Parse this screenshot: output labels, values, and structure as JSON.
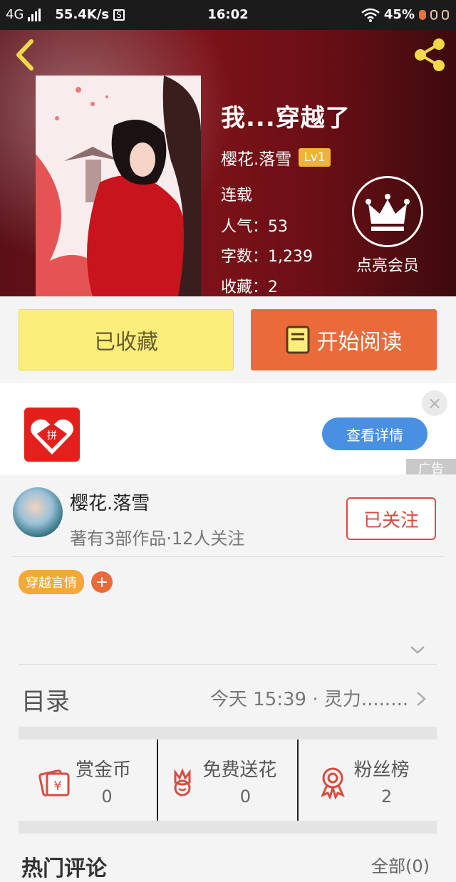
{
  "status_bar": {
    "network": "4G",
    "speed": "55.4K/s",
    "speed_icon": "S",
    "time": "16:02",
    "battery": "45%"
  },
  "hero": {
    "title": "我...穿越了",
    "author": "樱花.落雪",
    "level": "Lv1",
    "status": "连载",
    "popularity": "人气：53",
    "word_count": "字数：1,239",
    "favorites": "收藏：2",
    "vip_label": "点亮会员"
  },
  "actions": {
    "collected_label": "已收藏",
    "read_label": "开始阅读"
  },
  "ad": {
    "detail_label": "查看详情",
    "close_glyph": "×",
    "tag": "广告",
    "logo_glyph": "拼"
  },
  "author_card": {
    "name": "樱花.落雪",
    "meta": "著有3部作品·12人关注",
    "follow_label": "已关注"
  },
  "tags": [
    {
      "label": "穿越言情"
    }
  ],
  "tag_add": "+",
  "catalog": {
    "label": "目录",
    "latest": "今天 15:39 · 灵力........"
  },
  "rewards": [
    {
      "name": "赏金币",
      "count": "0",
      "icon": "coin-envelope-icon"
    },
    {
      "name": "免费送花",
      "count": "0",
      "icon": "flower-icon"
    },
    {
      "name": "粉丝榜",
      "count": "2",
      "icon": "medal-icon"
    }
  ],
  "bottom": {
    "left": "热门评论",
    "right": "全部(0)"
  },
  "colors": {
    "accent_orange": "#ea6a3a",
    "collected_yellow": "#fbee7a",
    "follow_red": "#d94b3f",
    "ad_blue": "#4a90e2"
  }
}
